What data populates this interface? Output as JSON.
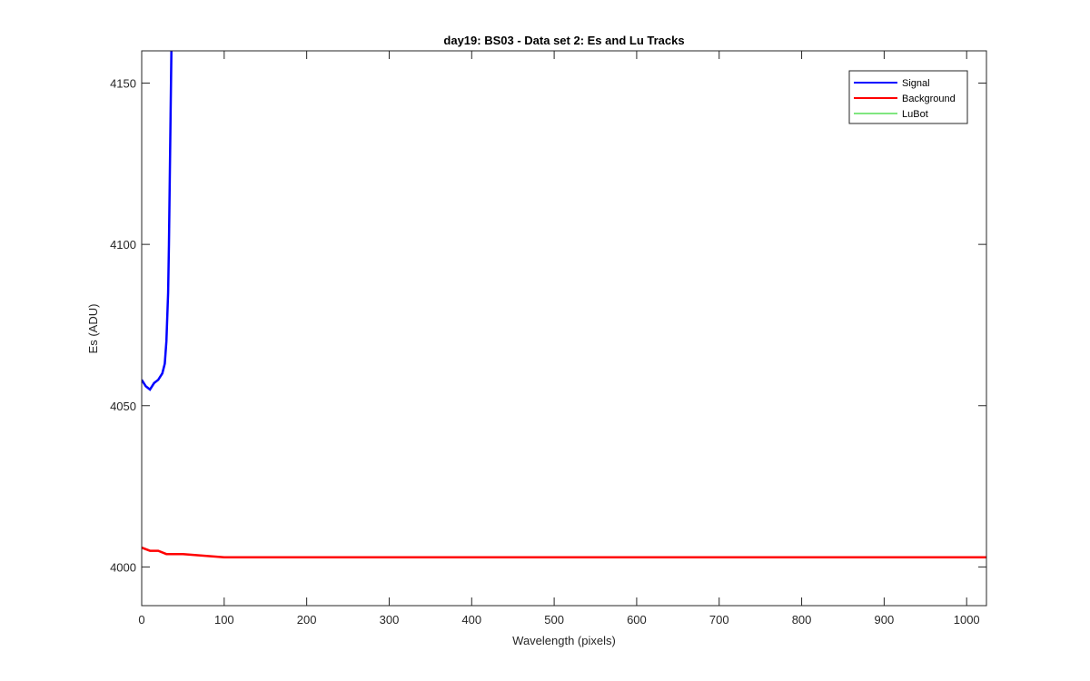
{
  "chart_data": {
    "type": "line",
    "title": "day19: BS03 - Data set 2: Es and Lu Tracks",
    "xlabel": "Wavelength (pixels)",
    "ylabel": "Es (ADU)",
    "xlim": [
      0,
      1024
    ],
    "ylim": [
      3988,
      4160
    ],
    "xticks": [
      0,
      100,
      200,
      300,
      400,
      500,
      600,
      700,
      800,
      900,
      1000
    ],
    "xtick_labels": [
      "0",
      "100",
      "200",
      "300",
      "400",
      "500",
      "600",
      "700",
      "800",
      "900",
      "1000"
    ],
    "yticks": [
      4000,
      4050,
      4100,
      4150
    ],
    "ytick_labels": [
      "4000",
      "4050",
      "4100",
      "4150"
    ],
    "grid": false,
    "legend_position": "top-right",
    "colors": {
      "signal": "#0000ff",
      "background": "#ff0000",
      "lubot": "#00cc00"
    },
    "series": [
      {
        "name": "Signal",
        "color": "#0000ff",
        "x": [
          0,
          5,
          10,
          15,
          20,
          25,
          28,
          30,
          32,
          33,
          34,
          35,
          36,
          38
        ],
        "y": [
          4058,
          4056,
          4055,
          4057,
          4058,
          4060,
          4063,
          4070,
          4085,
          4100,
          4120,
          4140,
          4160,
          4200
        ]
      },
      {
        "name": "Background",
        "color": "#ff0000",
        "x": [
          0,
          10,
          20,
          30,
          50,
          100,
          200,
          300,
          400,
          500,
          600,
          700,
          800,
          900,
          1000,
          1024
        ],
        "y": [
          4006,
          4005,
          4005,
          4004,
          4004,
          4003,
          4003,
          4003,
          4003,
          4003,
          4003,
          4003,
          4003,
          4003,
          4003,
          4003
        ]
      },
      {
        "name": "LuBot",
        "color": "#00cc00",
        "x": [],
        "y": []
      }
    ]
  }
}
